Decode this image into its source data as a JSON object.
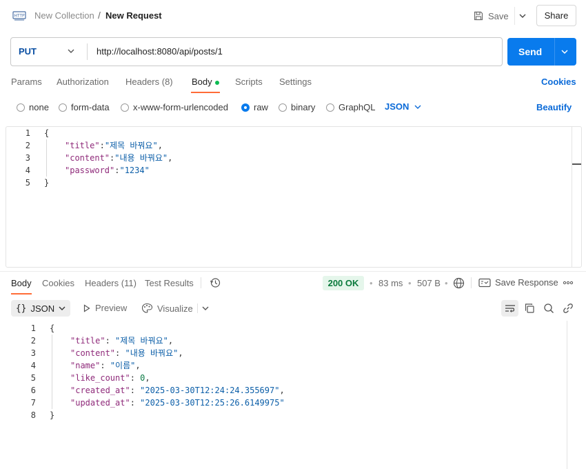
{
  "header": {
    "collection": "New Collection",
    "separator": "/",
    "request_name": "New Request",
    "save_label": "Save",
    "share_label": "Share"
  },
  "request": {
    "method": "PUT",
    "url": "http://localhost:8080/api/posts/1",
    "send_label": "Send"
  },
  "request_tabs": {
    "params": "Params",
    "authorization": "Authorization",
    "headers": "Headers (8)",
    "body": "Body",
    "scripts": "Scripts",
    "settings": "Settings",
    "cookies": "Cookies",
    "active": "Body"
  },
  "body_types": {
    "none": "none",
    "form_data": "form-data",
    "urlencoded": "x-www-form-urlencoded",
    "raw": "raw",
    "binary": "binary",
    "graphql": "GraphQL",
    "selected": "raw",
    "format": "JSON",
    "beautify": "Beautify"
  },
  "request_body": {
    "line_numbers": [
      "1",
      "2",
      "3",
      "4",
      "5"
    ],
    "open": "{",
    "close": "}",
    "fields": [
      {
        "key": "\"title\"",
        "sep": ":",
        "value": "\"제목 바꿔요\"",
        "end": ","
      },
      {
        "key": "\"content\"",
        "sep": ":",
        "value": "\"내용 바꿔요\"",
        "end": ","
      },
      {
        "key": "\"password\"",
        "sep": ":",
        "value": "\"1234\"",
        "end": ""
      }
    ]
  },
  "response_tabs": {
    "body": "Body",
    "cookies": "Cookies",
    "headers": "Headers (11)",
    "test_results": "Test Results",
    "status": "200 OK",
    "time": "83 ms",
    "size": "507 B",
    "save_response": "Save Response",
    "dot": "•"
  },
  "response_toolbar": {
    "braces": "{}",
    "format": "JSON",
    "preview": "Preview",
    "visualize": "Visualize"
  },
  "response_body": {
    "line_numbers": [
      "1",
      "2",
      "3",
      "4",
      "5",
      "6",
      "7",
      "8"
    ],
    "open": "{",
    "close": "}",
    "fields": [
      {
        "key": "\"title\"",
        "sep": ": ",
        "value": "\"제목 바꿔요\"",
        "end": ",",
        "type": "str"
      },
      {
        "key": "\"content\"",
        "sep": ": ",
        "value": "\"내용 바꿔요\"",
        "end": ",",
        "type": "str"
      },
      {
        "key": "\"name\"",
        "sep": ": ",
        "value": "\"이름\"",
        "end": ",",
        "type": "str"
      },
      {
        "key": "\"like_count\"",
        "sep": ": ",
        "value": "0",
        "end": ",",
        "type": "num"
      },
      {
        "key": "\"created_at\"",
        "sep": ": ",
        "value": "\"2025-03-30T12:24:24.355697\"",
        "end": ",",
        "type": "str"
      },
      {
        "key": "\"updated_at\"",
        "sep": ": ",
        "value": "\"2025-03-30T12:25:26.6149975\"",
        "end": "",
        "type": "str"
      }
    ]
  },
  "colors": {
    "accent": "#097bed",
    "tab_underline": "#ff6c37",
    "status_ok": "#0a7a3c"
  },
  "icons": [
    "http-icon",
    "save-icon",
    "chevron-down-icon",
    "history-icon",
    "globe-icon",
    "save-response-icon",
    "more-icon",
    "play-icon",
    "visualize-icon",
    "wrap-icon",
    "copy-icon",
    "search-icon",
    "link-icon"
  ]
}
